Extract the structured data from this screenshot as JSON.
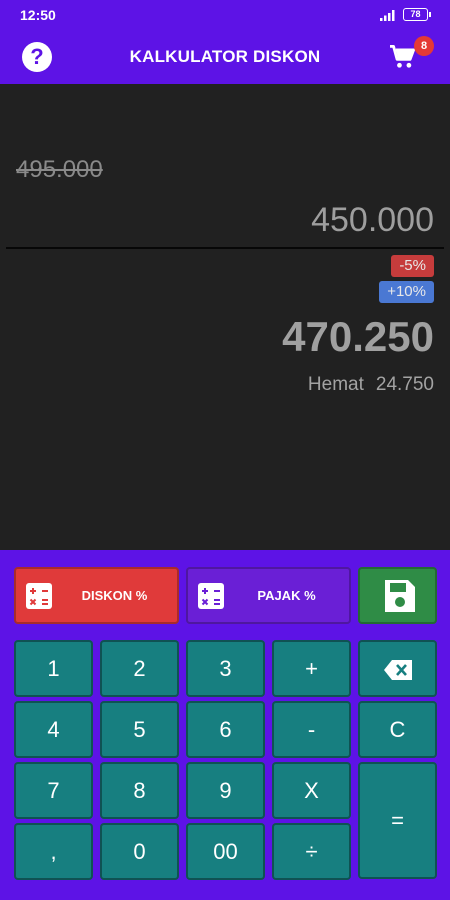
{
  "status_bar": {
    "time": "12:50",
    "battery": "78"
  },
  "app_bar": {
    "title": "KALKULATOR DISKON",
    "help_label": "?",
    "cart_badge": "8"
  },
  "display": {
    "original_price": "495.000",
    "input_price": "450.000",
    "discount_chip": "-5%",
    "tax_chip": "+10%",
    "result": "470.250",
    "savings_label": "Hemat",
    "savings_value": "24.750"
  },
  "functions": {
    "diskon_label": "DISKON %",
    "pajak_label": "PAJAK %"
  },
  "keys": {
    "k1": "1",
    "k2": "2",
    "k3": "3",
    "plus": "+",
    "k4": "4",
    "k5": "5",
    "k6": "6",
    "minus": "-",
    "clear": "C",
    "k7": "7",
    "k8": "8",
    "k9": "9",
    "times": "X",
    "equals": "=",
    "comma": ",",
    "k0": "0",
    "k00": "00",
    "divide": "÷"
  },
  "colors": {
    "primary": "#5d13e6",
    "display_bg": "#212121",
    "diskon_btn": "#e03a3a",
    "pajak_btn": "#6a1fd6",
    "save_btn": "#2f8c46",
    "key": "#177f80",
    "badge": "#e53935",
    "discount_chip": "#c63c3c",
    "tax_chip": "#4a78d3"
  },
  "icons": {
    "help": "help-icon",
    "cart": "cart-icon",
    "backspace": "backspace-icon",
    "save": "floppy-disk-icon",
    "calculator": "calculator-icon"
  }
}
